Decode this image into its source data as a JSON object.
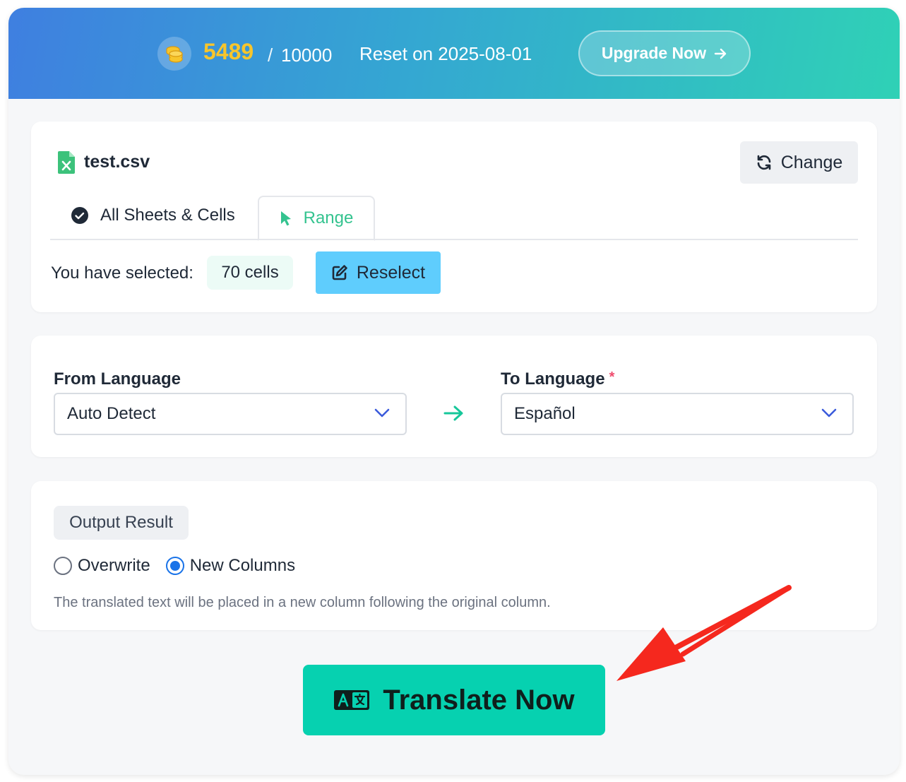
{
  "header": {
    "credits_used": "5489",
    "separator": "/",
    "credits_total": "10000",
    "reset_text": "Reset on 2025-08-01",
    "upgrade_label": "Upgrade Now",
    "coin_icon": "coins-icon",
    "accent_color": "#f7c52c"
  },
  "file": {
    "name": "test.csv",
    "icon": "excel-file-icon",
    "change_label": "Change"
  },
  "tabs": [
    {
      "label": "All Sheets & Cells",
      "icon": "check-circle-icon",
      "active": false
    },
    {
      "label": "Range",
      "icon": "cursor-pointer-icon",
      "active": true
    }
  ],
  "selection": {
    "label": "You have selected:",
    "cells": "70 cells",
    "reselect_label": "Reselect"
  },
  "languages": {
    "from_label": "From Language",
    "from_value": "Auto Detect",
    "to_label": "To Language",
    "required_mark": "*",
    "to_value": "Español"
  },
  "output": {
    "title": "Output Result",
    "options": [
      "Overwrite",
      "New Columns"
    ],
    "selected": "New Columns",
    "help": "The translated text will be placed in a new column following the original column."
  },
  "action": {
    "translate_label": "Translate Now",
    "icon": "translate-icon",
    "color": "#06d1b0"
  },
  "annotation": {
    "arrow_color": "#f5281e"
  }
}
